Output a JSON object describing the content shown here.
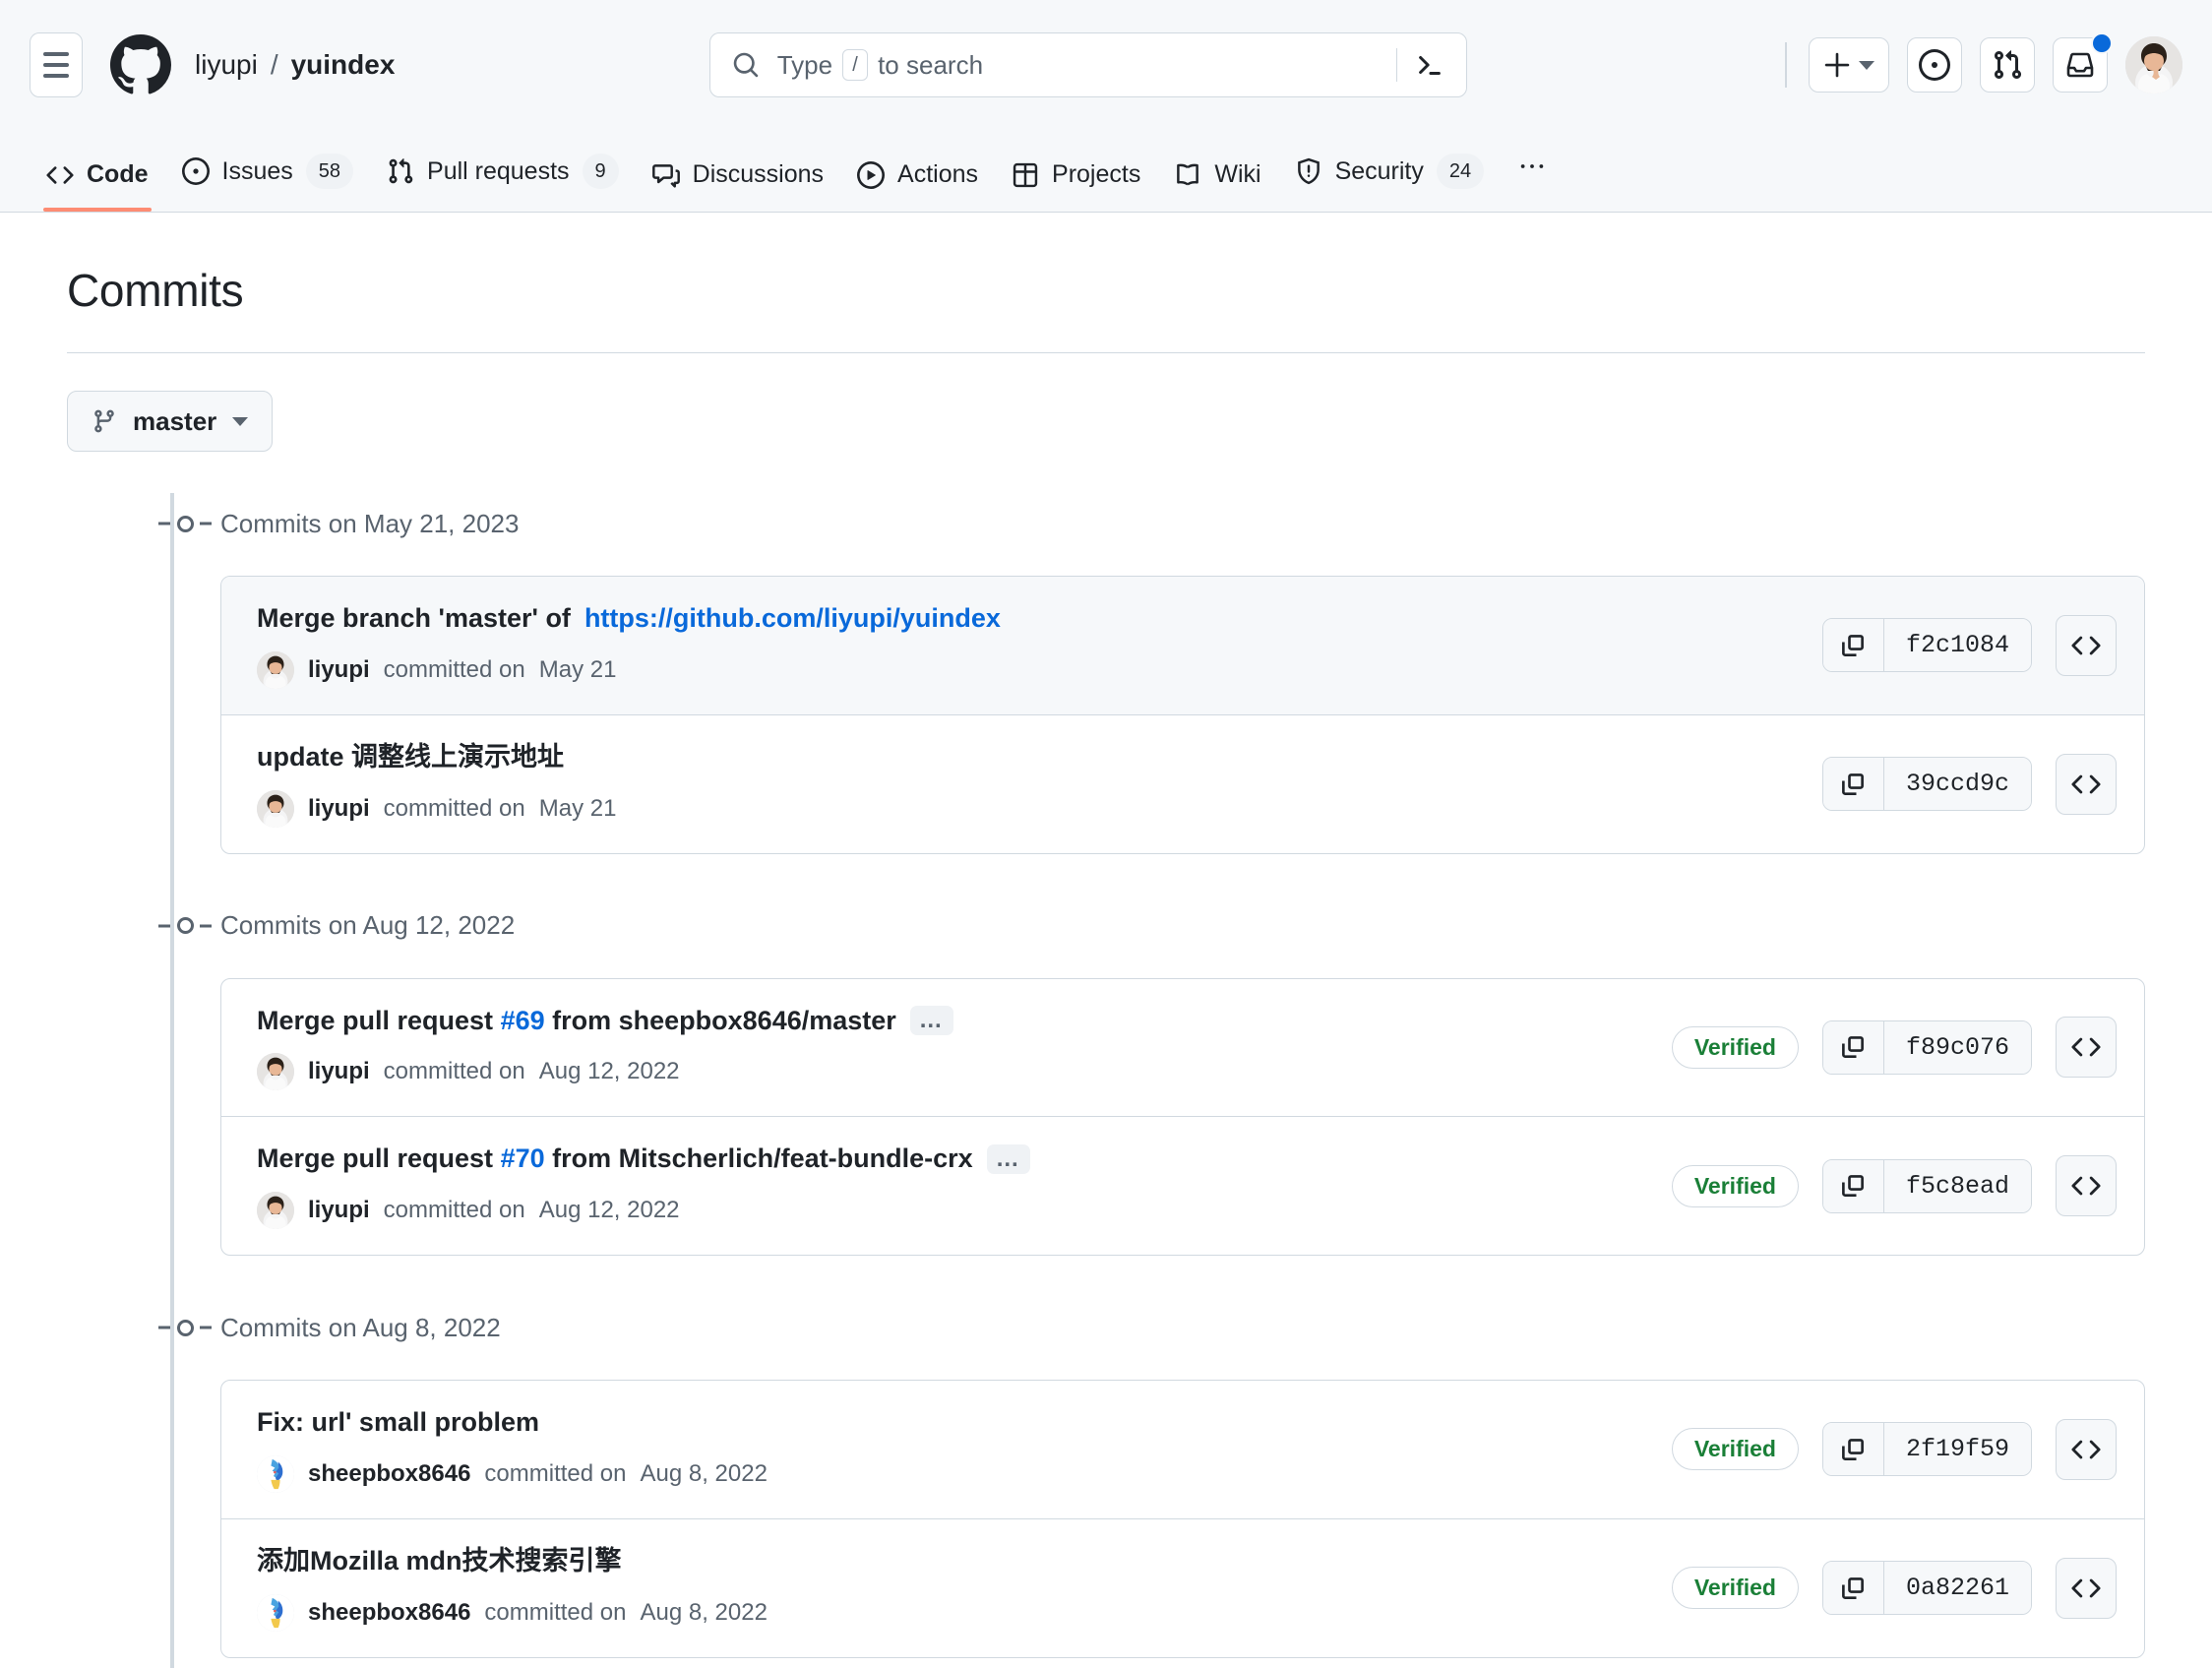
{
  "header": {
    "menu_icon": "hamburger-icon",
    "logo_icon": "github-logo-icon",
    "repo_owner": "liyupi",
    "repo_separator": "/",
    "repo_name": "yuindex",
    "search": {
      "icon": "search-icon",
      "prefix": "Type",
      "key": "/",
      "suffix": "to search",
      "placeholder": "Type / to search",
      "terminal_icon": "command-palette-icon"
    },
    "actions": {
      "create_icon": "plus-icon",
      "create_caret_icon": "chevron-down-icon",
      "issues_icon": "issue-opened-icon",
      "pull_requests_icon": "git-pull-request-icon",
      "inbox_icon": "inbox-icon",
      "avatar_icon": "user-avatar"
    }
  },
  "repo_nav": {
    "tabs": [
      {
        "label": "Code",
        "icon": "code-icon",
        "count": "",
        "active": true
      },
      {
        "label": "Issues",
        "icon": "issue-opened-icon",
        "count": "58",
        "active": false
      },
      {
        "label": "Pull requests",
        "icon": "git-pull-request-icon",
        "count": "9",
        "active": false
      },
      {
        "label": "Discussions",
        "icon": "comment-discussion-icon",
        "count": "",
        "active": false
      },
      {
        "label": "Actions",
        "icon": "play-icon",
        "count": "",
        "active": false
      },
      {
        "label": "Projects",
        "icon": "table-icon",
        "count": "",
        "active": false
      },
      {
        "label": "Wiki",
        "icon": "book-icon",
        "count": "",
        "active": false
      },
      {
        "label": "Security",
        "icon": "shield-icon",
        "count": "24",
        "active": false
      }
    ],
    "overflow_label": "•••"
  },
  "page": {
    "title": "Commits",
    "branch_button": {
      "icon": "git-branch-icon",
      "label": "master",
      "caret_icon": "chevron-down-icon"
    }
  },
  "colors": {
    "accent_link": "#0969da",
    "verified_green": "#1a7f37",
    "active_tab_underline": "#fd8c73",
    "border": "#d1d9e0",
    "muted_text": "#59636e",
    "canvas_subtle": "#f6f8fa"
  },
  "groups": [
    {
      "label": "Commits on May 21, 2023",
      "commits": [
        {
          "title_prefix": "Merge branch 'master' of ",
          "title_link": "https://github.com/liyupi/yuindex",
          "link_number": "",
          "title_suffix": "",
          "has_expand": false,
          "expand_label": "",
          "author": "liyupi",
          "author_avatar": "liyupi-avatar",
          "meta_verb": "committed on",
          "date": "May 21",
          "verified": "",
          "sha": "f2c1084",
          "highlight": true
        },
        {
          "title_prefix": "update 调整线上演示地址",
          "title_link": "",
          "link_number": "",
          "title_suffix": "",
          "has_expand": false,
          "expand_label": "",
          "author": "liyupi",
          "author_avatar": "liyupi-avatar",
          "meta_verb": "committed on",
          "date": "May 21",
          "verified": "",
          "sha": "39ccd9c",
          "highlight": false
        }
      ]
    },
    {
      "label": "Commits on Aug 12, 2022",
      "commits": [
        {
          "title_prefix": "Merge pull request ",
          "title_link": "",
          "link_number": "#69",
          "title_suffix": " from sheepbox8646/master",
          "has_expand": true,
          "expand_label": "…",
          "author": "liyupi",
          "author_avatar": "liyupi-avatar",
          "meta_verb": "committed on",
          "date": "Aug 12, 2022",
          "verified": "Verified",
          "sha": "f89c076",
          "highlight": false
        },
        {
          "title_prefix": "Merge pull request ",
          "title_link": "",
          "link_number": "#70",
          "title_suffix": " from Mitscherlich/feat-bundle-crx",
          "has_expand": true,
          "expand_label": "…",
          "author": "liyupi",
          "author_avatar": "liyupi-avatar",
          "meta_verb": "committed on",
          "date": "Aug 12, 2022",
          "verified": "Verified",
          "sha": "f5c8ead",
          "highlight": false
        }
      ]
    },
    {
      "label": "Commits on Aug 8, 2022",
      "commits": [
        {
          "title_prefix": "Fix: url' small problem",
          "title_link": "",
          "link_number": "",
          "title_suffix": "",
          "has_expand": false,
          "expand_label": "",
          "author": "sheepbox8646",
          "author_avatar": "sheepbox8646-avatar",
          "meta_verb": "committed on",
          "date": "Aug 8, 2022",
          "verified": "Verified",
          "sha": "2f19f59",
          "highlight": false
        },
        {
          "title_prefix": "添加Mozilla mdn技术搜索引擎",
          "title_link": "",
          "link_number": "",
          "title_suffix": "",
          "has_expand": false,
          "expand_label": "",
          "author": "sheepbox8646",
          "author_avatar": "sheepbox8646-avatar",
          "meta_verb": "committed on",
          "date": "Aug 8, 2022",
          "verified": "Verified",
          "sha": "0a82261",
          "highlight": false
        }
      ]
    }
  ],
  "common": {
    "copy_icon": "copy-icon",
    "browse_icon": "code-brackets-icon"
  }
}
